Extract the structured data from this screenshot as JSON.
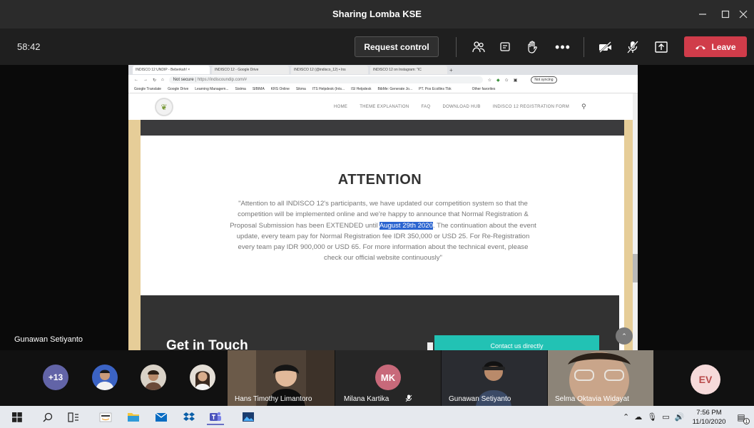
{
  "window": {
    "title": "Sharing Lomba KSE"
  },
  "toolbar": {
    "timer": "58:42",
    "request_control": "Request control",
    "leave": "Leave"
  },
  "presenter": {
    "name": "Gunawan Setiyanto"
  },
  "browser": {
    "tabs": [
      "INDISCO 12 UNDIP - Beberkah! ×",
      "INDISCO 12 - Google Drive",
      "INDISCO 12 (@indisco_12) • Ins",
      "INDISCO 12 on Instagram: \"IC"
    ],
    "url_prefix": "Not secure",
    "url": "https://indiscoundip.com/#",
    "sync": "Not syncing",
    "bookmarks": [
      "Google Translate",
      "Google Drive",
      "Learning Managem...",
      "Sistma",
      "SIBIMA",
      "KRS Online",
      "Sikma",
      "ITS Helpdesk (Ints...",
      "ISI Helpdesk",
      "BibMe: Generate Jo...",
      "PT. Pos Ecollins Tbk",
      "Other favorites"
    ]
  },
  "site": {
    "menu": [
      "HOME",
      "THEME EXPLANATION",
      "FAQ",
      "DOWNLOAD HUB",
      "INDISCO 12 REGISTRATION FORM"
    ],
    "attention_title": "ATTENTION",
    "body_before": "\"Attention to all INDISCO 12's participants, we have updated our competition system so that the competition will be implemented online and we're happy to announce that Normal Registration & Proposal Submission has been EXTENDED until ",
    "body_highlight": "August 29th 2020",
    "body_after": ". The continuation about the event update, every team pay for Normal Registration fee IDR 350,000 or USD 25. For Re-Registration every team pay IDR 900,000 or USD 65. For more information about the technical event, please check our official website continuously\"",
    "get_in_touch": "Get in Touch",
    "contact_button": "Contact us directly"
  },
  "participants": {
    "more_count": "+13",
    "tiles": [
      {
        "name": "Hans Timothy Limantoro"
      },
      {
        "name": "Milana Kartika",
        "initials": "MK"
      },
      {
        "name": "Gunawan Setiyanto"
      },
      {
        "name": "Selma Oktavia Widayat"
      }
    ],
    "last_initials": "EV"
  },
  "taskbar": {
    "time": "7:56 PM",
    "date": "11/10/2020",
    "notif_count": "1"
  },
  "colors": {
    "leave": "#d03c4a",
    "teams_purple": "#6264a7",
    "highlight": "#2a64d0",
    "contact_teal": "#22c2b4"
  }
}
